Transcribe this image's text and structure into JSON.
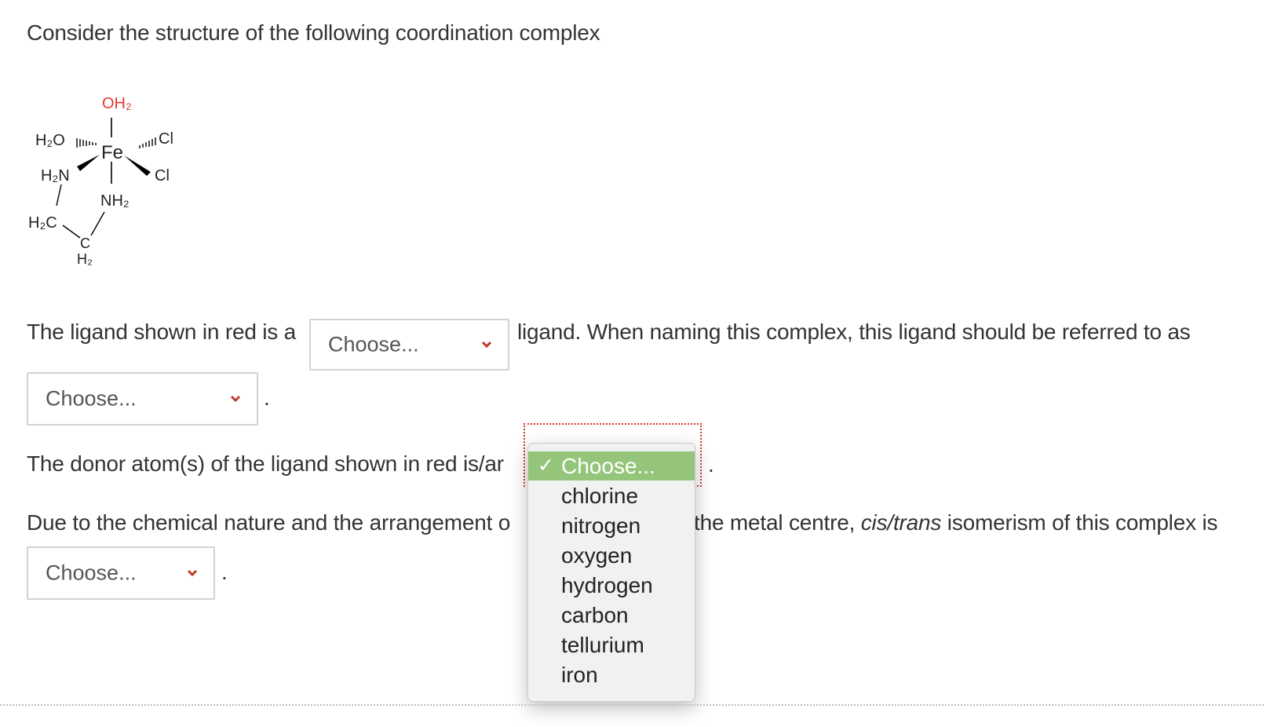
{
  "question": {
    "intro": "Consider the structure of the following coordination complex",
    "line1_before": "The ligand shown in red is a",
    "line1_after": "ligand. When naming this complex, this ligand should be referred to as",
    "line2_after": ".",
    "line3_before": "The donor atom(s) of the ligand shown in red is/ar",
    "line3_after": ".",
    "line4_before": "Due to the chemical nature and the arrangement o",
    "line4_after_plain1": "the metal centre,",
    "line4_italic": "cis/trans",
    "line4_after_plain2": "isomerism of this complex is",
    "line5_after": "."
  },
  "selects": {
    "ligand_type": "Choose...",
    "ligand_name": "Choose...",
    "donor_atoms": "Choose...",
    "isomerism": "Choose..."
  },
  "dropdown": {
    "check": "✓",
    "options": [
      "Choose...",
      "chlorine",
      "nitrogen",
      "oxygen",
      "hydrogen",
      "carbon",
      "tellurium",
      "iron"
    ]
  },
  "molecule": {
    "metal": "Fe",
    "top": "OH₂",
    "upper_left": "H₂O",
    "upper_right": "Cl",
    "right": "Cl",
    "left": "H₂N",
    "bottom": "NH₂",
    "ch2_left": "H₂C",
    "ch2_bottom_c": "C",
    "ch2_bottom_h": "H₂"
  },
  "colors": {
    "red_ligand": "#e0392b",
    "selected_option": "#95c57b",
    "chevron": "#c0392b"
  }
}
